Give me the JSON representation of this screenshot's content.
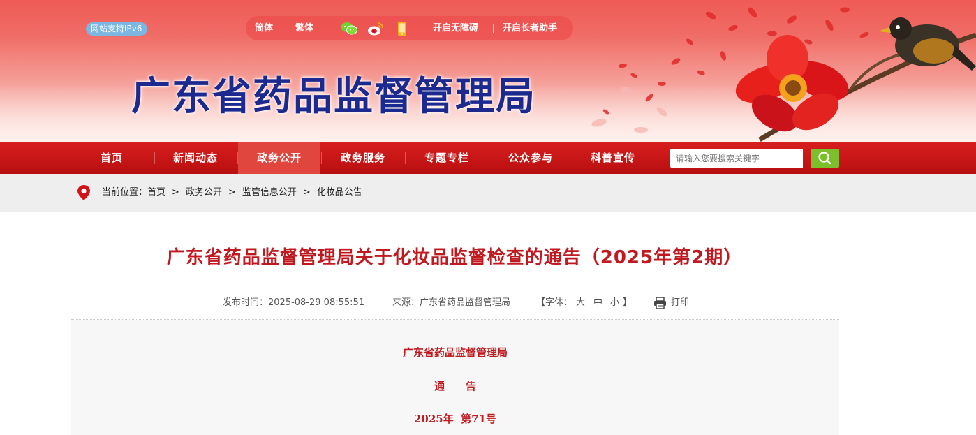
{
  "header": {
    "ipv6_badge": "网站支持IPv6",
    "lang_simplified": "简体",
    "lang_traditional": "繁体",
    "accessibility": "开启无障碍",
    "elder_mode": "开启长者助手",
    "icons": [
      "wechat-icon",
      "weibo-icon",
      "mobile-icon"
    ],
    "site_title": "广东省药品监督管理局"
  },
  "nav": {
    "items": [
      {
        "label": "首页",
        "active": false
      },
      {
        "label": "新闻动态",
        "active": false
      },
      {
        "label": "政务公开",
        "active": true
      },
      {
        "label": "政务服务",
        "active": false
      },
      {
        "label": "专题专栏",
        "active": false
      },
      {
        "label": "公众参与",
        "active": false
      },
      {
        "label": "科普宣传",
        "active": false
      }
    ],
    "search_placeholder": "请输入您要搜索关键字"
  },
  "breadcrumb": {
    "prefix": "当前位置：",
    "items": [
      "首页",
      "政务公开",
      "监管信息公开",
      "化妆品公告"
    ],
    "separator": ">"
  },
  "article": {
    "title": "广东省药品监督管理局关于化妆品监督检查的通告（2025年第2期）",
    "publish_time": "发布时间：2025-08-29 08:55:51",
    "source": "来源：广东省药品监督管理局",
    "font_size_label": "【字体：",
    "font_large": "大",
    "font_medium": "中",
    "font_small": "小",
    "font_close": "】",
    "print": "打印",
    "body": {
      "issuer": "广东省药品监督管理局",
      "doc_type": "通　　告",
      "doc_number": "2025年  第71号"
    }
  },
  "colors": {
    "nav_red": "#c8161b",
    "nav_active": "#e0463e",
    "title_red": "#c01920",
    "site_title_blue": "#1c2a8f",
    "search_green": "#7bc02a",
    "ipv6_blue": "#7cb7e3"
  }
}
